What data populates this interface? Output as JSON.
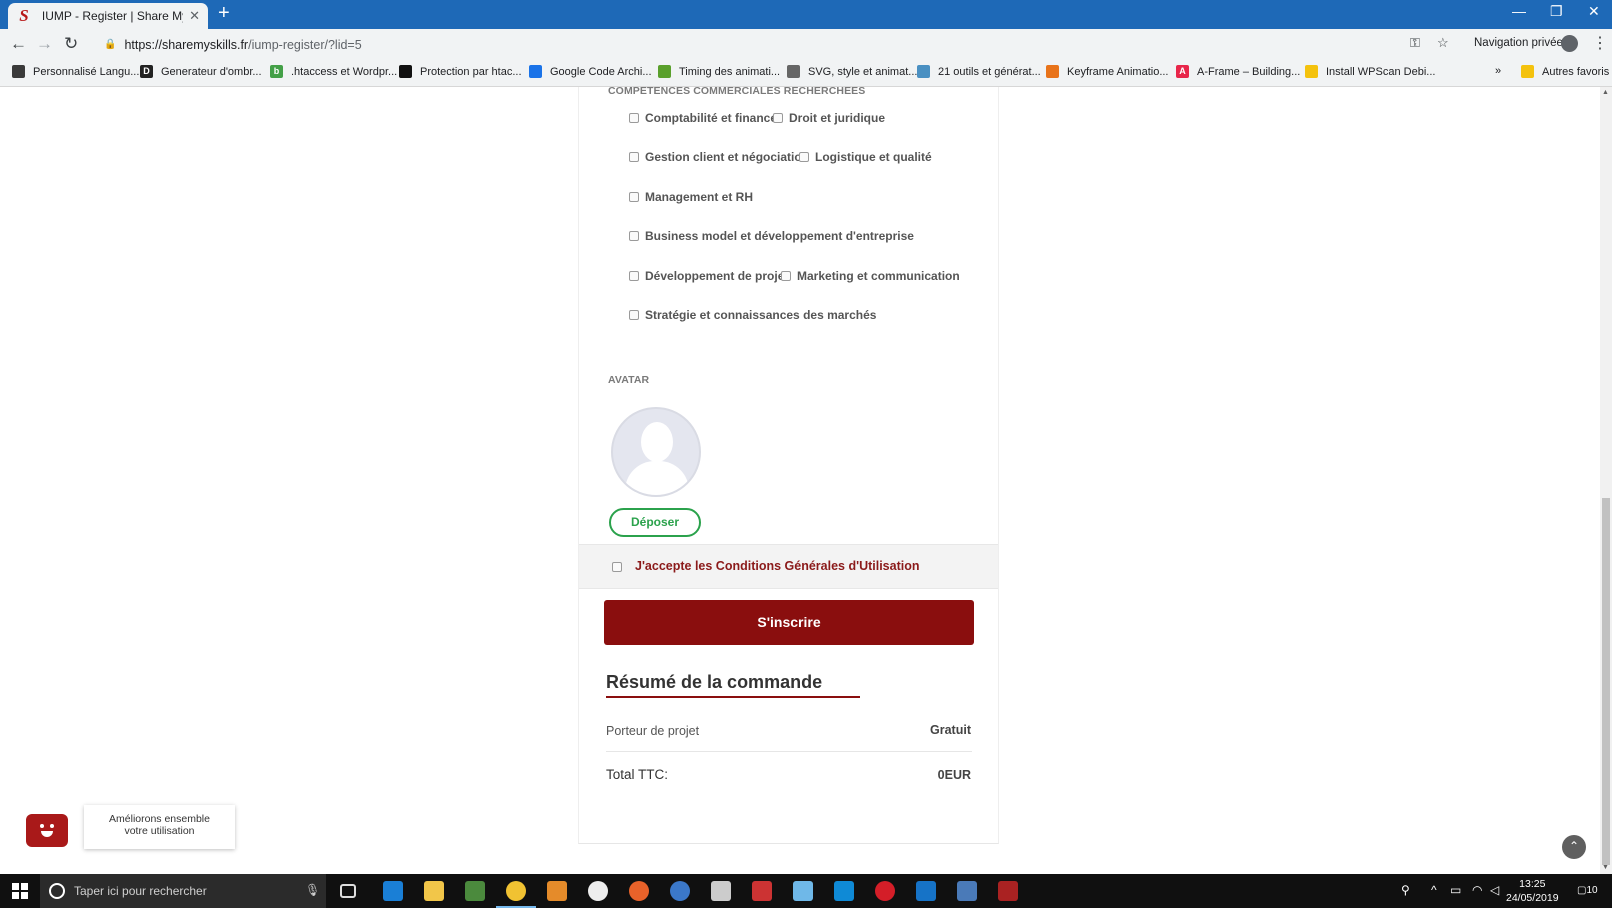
{
  "browser": {
    "tab_title": "IUMP - Register | Share My Skills",
    "tab_icon": "S",
    "url_host": "https://sharemyskills.fr",
    "url_path": "/iump-register/?lid=5",
    "private_label": "Navigation privée",
    "bookmarks": [
      {
        "label": "Personnalisé Langu...",
        "color": "#3a3a3a",
        "glyph": ""
      },
      {
        "label": "Generateur d'ombr...",
        "color": "#222222",
        "glyph": "D"
      },
      {
        "label": ".htaccess et Wordpr...",
        "color": "#43a047",
        "glyph": "b"
      },
      {
        "label": "Protection par htac...",
        "color": "#111111",
        "glyph": ""
      },
      {
        "label": "Google Code Archi...",
        "color": "#1a73e8",
        "glyph": ""
      },
      {
        "label": "Timing des animati...",
        "color": "#5aa02c",
        "glyph": ""
      },
      {
        "label": "SVG, style et animat...",
        "color": "#666666",
        "glyph": ""
      },
      {
        "label": "21 outils et générat...",
        "color": "#4a90c2",
        "glyph": ""
      },
      {
        "label": "Keyframe Animatio...",
        "color": "#e8731a",
        "glyph": ""
      },
      {
        "label": "A-Frame – Building...",
        "color": "#e8264a",
        "glyph": "A"
      },
      {
        "label": "Install WPScan Debi...",
        "color": "#f4c20d",
        "glyph": ""
      }
    ],
    "bookmarks_more": "»",
    "other_bookmarks": "Autres favoris"
  },
  "form": {
    "section_skills_title": "COMPETENCES COMMERCIALES RECHERCHEES",
    "skills": [
      "Comptabilité et finance",
      "Droit et juridique",
      "Gestion client et négociation",
      "Logistique et qualité",
      "Management et RH",
      "Business model et développement d'entreprise",
      "Développement de projet",
      "Marketing et communication",
      "Stratégie et connaissances des marchés"
    ],
    "avatar_title": "AVATAR",
    "upload_label": "Déposer",
    "terms_label": "J'accepte les Conditions Générales d'Utilisation",
    "submit_label": "S'inscrire"
  },
  "summary": {
    "title": "Résumé de la commande",
    "plan_label": "Porteur de projet",
    "plan_value": "Gratuit",
    "total_label": "Total TTC:",
    "total_value": "0EUR"
  },
  "chat": {
    "tooltip_line1": "Améliorons ensemble",
    "tooltip_line2": "votre utilisation"
  },
  "taskbar": {
    "search_placeholder": "Taper ici pour rechercher",
    "time": "13:25",
    "date": "24/05/2019",
    "notification_count": "10"
  }
}
